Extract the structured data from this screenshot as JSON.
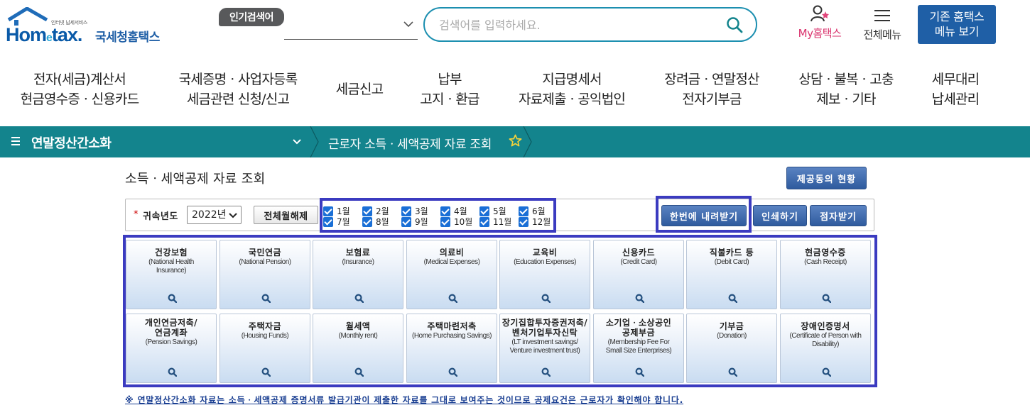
{
  "header": {
    "logo_tagline": "인터넷 납세서비스",
    "logo_brand_left": "Hom",
    "logo_brand_e": "e",
    "logo_brand_right": "tax.",
    "logo_korean": "국세청홈택스",
    "popular_label": "인기검색어",
    "search_placeholder": "검색어를 입력하세요.",
    "my_hometax": "My홈택스",
    "all_menu": "전체메뉴",
    "old_menu_line1": "기존 홈택스",
    "old_menu_line2": "메뉴 보기"
  },
  "gnb": [
    {
      "label": "전자(세금)계산서\n현금영수증ㆍ신용카드"
    },
    {
      "label": "국세증명ㆍ사업자등록\n세금관련 신청/신고"
    },
    {
      "label": "세금신고"
    },
    {
      "label": "납부\n고지ㆍ환급"
    },
    {
      "label": "지급명세서\n자료제출ㆍ공익법인"
    },
    {
      "label": "장려금ㆍ연말정산\n전자기부금"
    },
    {
      "label": "상담ㆍ불복ㆍ고충\n제보ㆍ기타"
    },
    {
      "label": "세무대리\n납세관리"
    }
  ],
  "navbar": {
    "section": "연말정산간소화",
    "breadcrumb": "근로자 소득ㆍ세액공제 자료 조회"
  },
  "content": {
    "title": "소득ㆍ세액공제 자료 조회",
    "provider_button": "제공동의 현황",
    "required_mark": "*",
    "year_label": "귀속년도",
    "year_value": "2022년",
    "clear_button": "전체월해제",
    "months": [
      "1월",
      "2월",
      "3월",
      "4월",
      "5월",
      "6월",
      "7월",
      "8월",
      "9월",
      "10월",
      "11월",
      "12월"
    ],
    "download_button": "한번에 내려받기",
    "print_button": "인쇄하기",
    "epaper_button": "점자받기",
    "tiles": [
      {
        "ko": "건강보험",
        "en": "(National Health\nInsurance)"
      },
      {
        "ko": "국민연금",
        "en": "(National Pension)"
      },
      {
        "ko": "보험료",
        "en": "(Insurance)"
      },
      {
        "ko": "의료비",
        "en": "(Medical Expenses)"
      },
      {
        "ko": "교육비",
        "en": "(Education Expenses)"
      },
      {
        "ko": "신용카드",
        "en": "(Credit Card)"
      },
      {
        "ko": "직불카드 등",
        "en": "(Debit Card)"
      },
      {
        "ko": "현금영수증",
        "en": "(Cash Receipt)"
      },
      {
        "ko": "개인연금저축/\n연금계좌",
        "en": "(Pension Savings)"
      },
      {
        "ko": "주택자금",
        "en": "(Housing Funds)"
      },
      {
        "ko": "월세액",
        "en": "(Monthly rent)"
      },
      {
        "ko": "주택마련저축",
        "en": "(Home Purchasing Savings)"
      },
      {
        "ko": "장기집합투자증권저축/\n벤처기업투자신탁",
        "en": "(LT investment savings/\nVenture investment trust)"
      },
      {
        "ko": "소기업ㆍ소상공인\n공제부금",
        "en": "(Membership Fee For\nSmall Size Enterprises)"
      },
      {
        "ko": "기부금",
        "en": "(Donation)"
      },
      {
        "ko": "장애인증명서",
        "en": "(Certificate of Person with\nDisability)"
      }
    ],
    "notice": "※ 연말정산간소화 자료는 소득ㆍ세액공제 증명서류 발급기관이 제출한 자료를 그대로 보여주는 것이므로 공제요건은 근로자가 확인해야 합니다."
  },
  "colors": {
    "navbar": "#13848d",
    "brand_blue": "#1f5fa6",
    "highlight_box": "#3b3bc0",
    "my_hometax": "#d9306b"
  }
}
